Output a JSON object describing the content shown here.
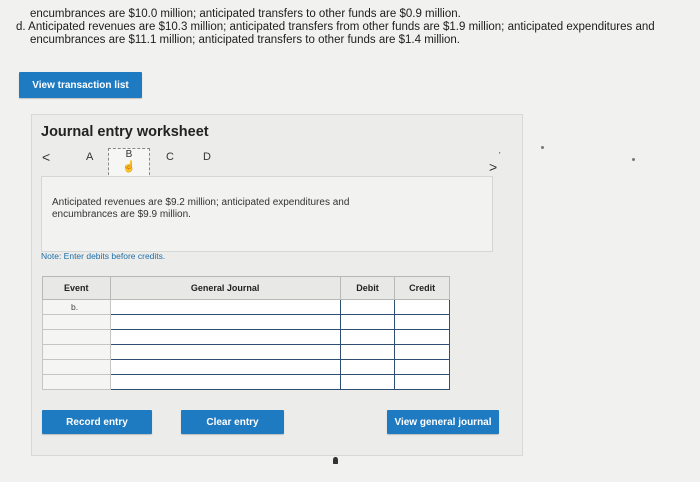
{
  "problem": {
    "line1": "encumbrances are $10.0 million; anticipated transfers to other funds are $0.9 million.",
    "line2": "d. Anticipated revenues are $10.3 million; anticipated transfers from other funds are $1.9 million; anticipated expenditures and",
    "line3": "encumbrances are $11.1 million; anticipated transfers to other funds are $1.4 million."
  },
  "buttons": {
    "view_transaction_list": "View transaction list",
    "record_entry": "Record entry",
    "clear_entry": "Clear entry",
    "view_general_journal": "View general journal"
  },
  "worksheet": {
    "title": "Journal entry worksheet",
    "nav": {
      "prev": "<",
      "a": "A",
      "b": "B",
      "c": "C",
      "d": "D",
      "next": ">"
    },
    "description": "Anticipated revenues are $9.2 million; anticipated expenditures and encumbrances are $9.9 million.",
    "note": "Note: Enter debits before credits."
  },
  "journal": {
    "headers": {
      "event": "Event",
      "general_journal": "General Journal",
      "debit": "Debit",
      "credit": "Credit"
    },
    "rows": [
      {
        "event": "b.",
        "account": "",
        "debit": "",
        "credit": ""
      },
      {
        "event": "",
        "account": "",
        "debit": "",
        "credit": ""
      },
      {
        "event": "",
        "account": "",
        "debit": "",
        "credit": ""
      },
      {
        "event": "",
        "account": "",
        "debit": "",
        "credit": ""
      },
      {
        "event": "",
        "account": "",
        "debit": "",
        "credit": ""
      },
      {
        "event": "",
        "account": "",
        "debit": "",
        "credit": ""
      }
    ]
  },
  "colors": {
    "button_blue": "#1e7ac1",
    "note_blue": "#1e6ea8",
    "input_border": "#2f4f70"
  }
}
